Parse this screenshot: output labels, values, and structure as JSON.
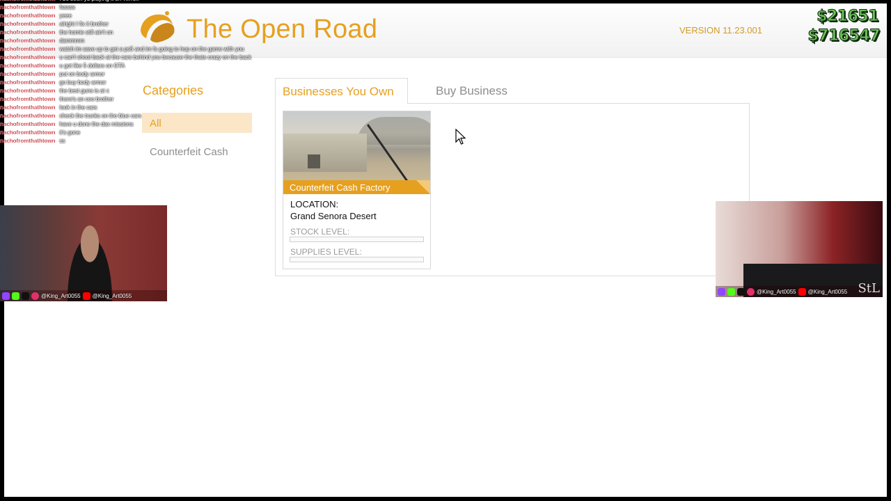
{
  "header": {
    "title": "The Open Road",
    "version": "VERSION 11.23.001",
    "cash": "$21651",
    "bank": "$716547"
  },
  "categories": {
    "title": "Categories",
    "items": [
      {
        "label": "All",
        "selected": true
      },
      {
        "label": "Counterfeit Cash",
        "selected": false
      }
    ]
  },
  "tabs": [
    {
      "label": "Businesses You Own",
      "active": true
    },
    {
      "label": "Buy Business",
      "active": false
    }
  ],
  "business": {
    "name": "Counterfeit Cash Factory",
    "location_label": "LOCATION:",
    "location": "Grand Senora Desert",
    "stock_label": "STOCK LEVEL:",
    "stock_level": 0,
    "supplies_label": "SUPPLIES LEVEL:",
    "supplies_level": 0
  },
  "chat": [
    {
      "user": "nachofromthathtown",
      "msg": "I be seen yu playing it on TikTok"
    },
    {
      "user": "nachofromthathtown",
      "msg": "fsssss"
    },
    {
      "user": "nachofromthathtown",
      "msg": "yeee"
    },
    {
      "user": "nachofromthathtown",
      "msg": "alright I fix it brother"
    },
    {
      "user": "nachofromthathtown",
      "msg": "the homie still ain't on"
    },
    {
      "user": "nachofromthathtown",
      "msg": "dammmm"
    },
    {
      "user": "nachofromthathtown",
      "msg": "watch im save up to get a ps5 and im fs going to hop on the game with you"
    },
    {
      "user": "nachofromthathtown",
      "msg": "u can't shoot back at the cars behind you because the thats crazy on the back"
    },
    {
      "user": "nachofromthathtown",
      "msg": "u got like 5 dollars on GTA"
    },
    {
      "user": "nachofromthathtown",
      "msg": "put on body armor"
    },
    {
      "user": "nachofromthathtown",
      "msg": "go buy body armor"
    },
    {
      "user": "nachofromthathtown",
      "msg": "the best guns is at c"
    },
    {
      "user": "nachofromthathtown",
      "msg": "there's an ceo brother"
    },
    {
      "user": "nachofromthathtown",
      "msg": "look in the cars"
    },
    {
      "user": "nachofromthathtown",
      "msg": "check the trunks on the blue cars"
    },
    {
      "user": "nachofromthathtown",
      "msg": "have u done the dax missions"
    },
    {
      "user": "nachofromthathtown",
      "msg": "it's gone"
    },
    {
      "user": "nachofromthathtown",
      "msg": "ss"
    }
  ],
  "streamer": {
    "left_handles": [
      "@King_Art0055",
      "@King_Art0055"
    ],
    "right_handles": [
      "@King_Art0055",
      "@King_Art0055"
    ],
    "right_logo": "StL"
  },
  "colors": {
    "accent": "#e6a01f",
    "money": "#6ec25a",
    "chat_user": "#c1121c"
  }
}
